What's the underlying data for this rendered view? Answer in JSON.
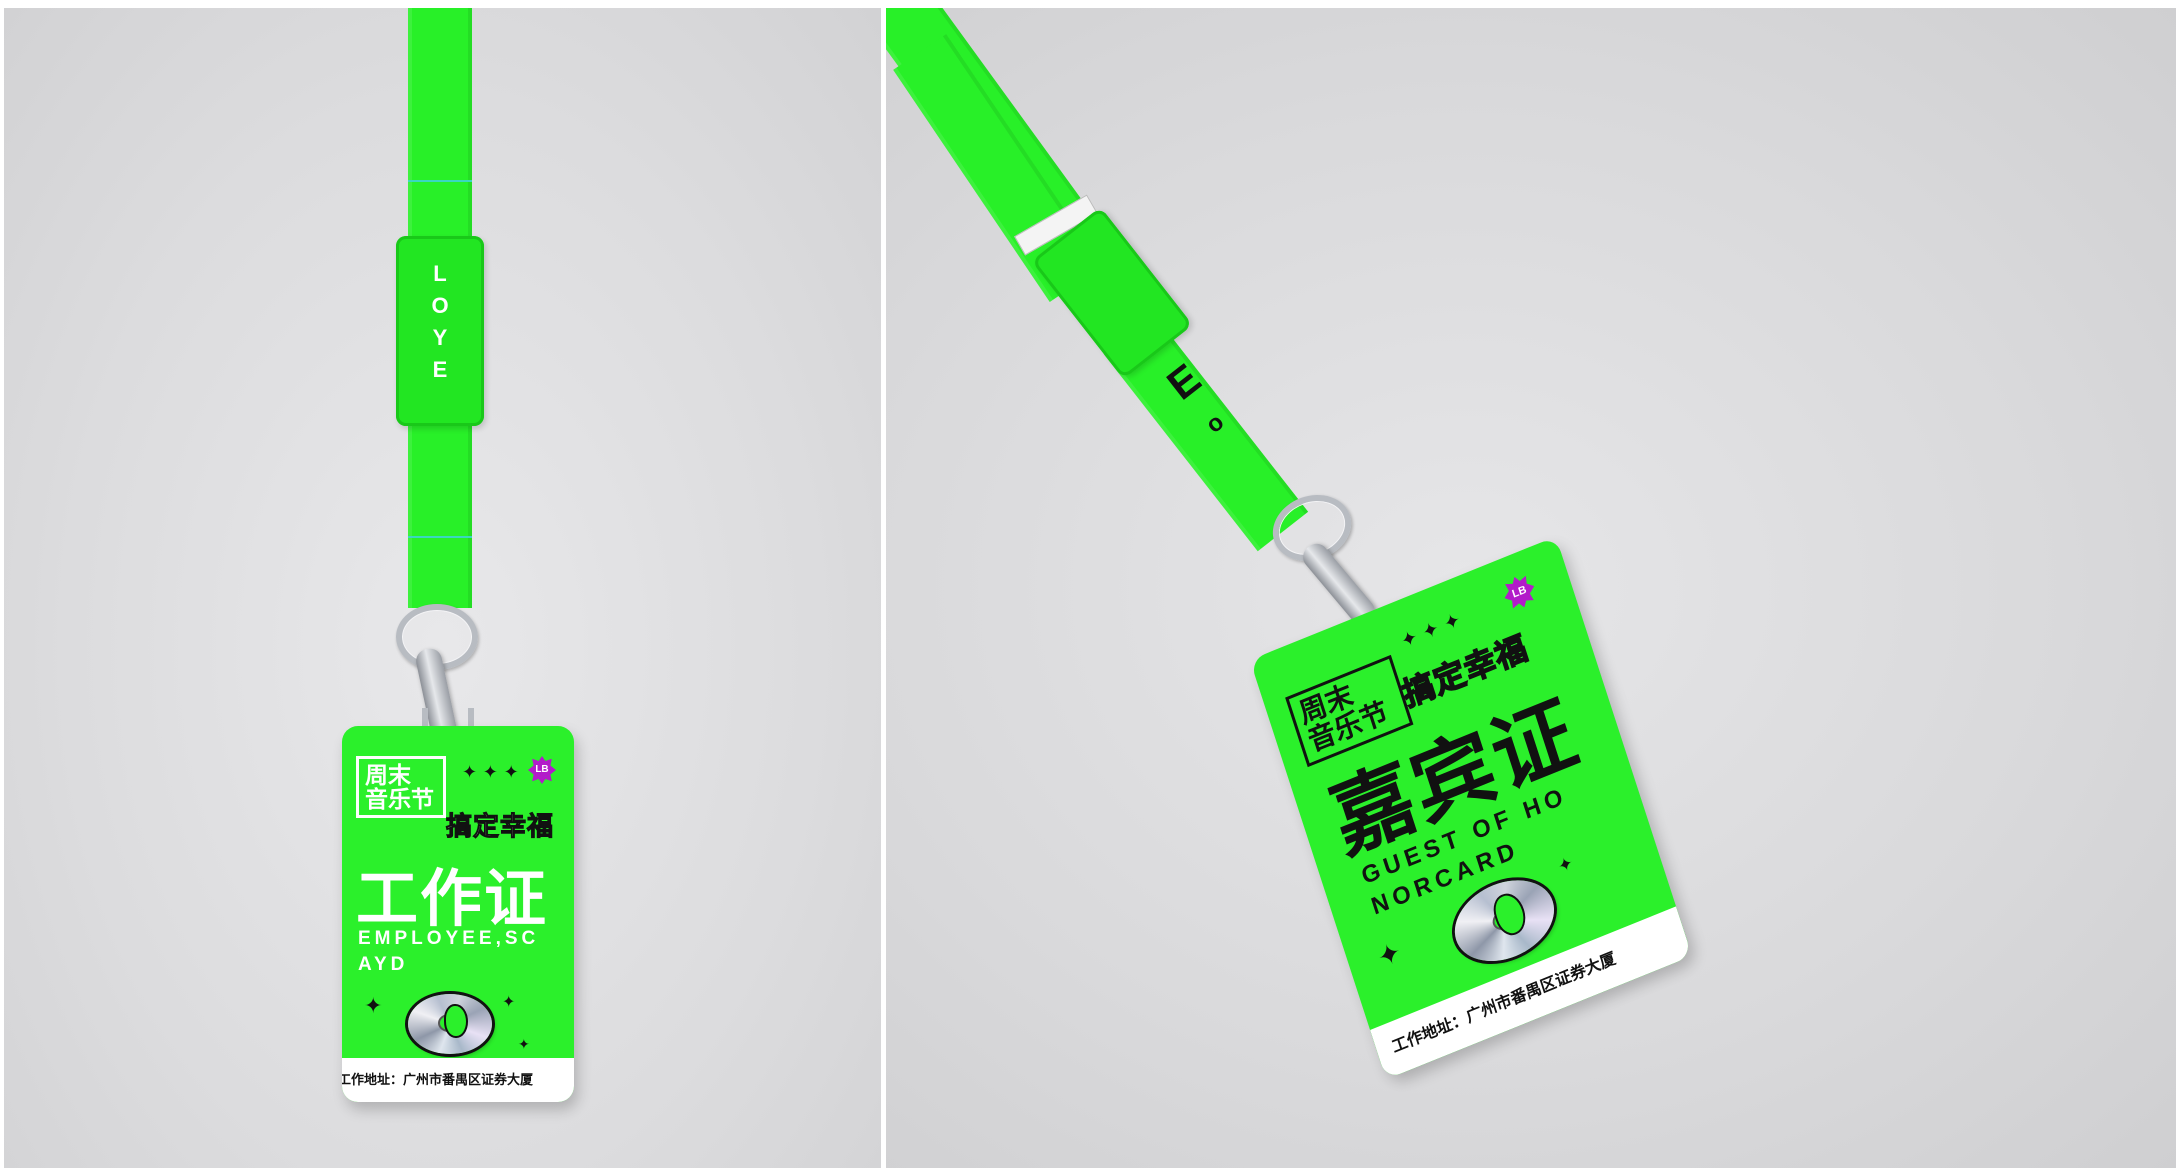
{
  "left_mockup": {
    "buckle_letters": [
      "L",
      "O",
      "Y",
      "E"
    ],
    "badge": {
      "event_name_line1": "周末",
      "event_name_line2": "音乐节",
      "slogan": "搞定幸福",
      "title": "工作证",
      "subtitle_line1": "EMPLOYEE,SC",
      "subtitle_line2": "AYD",
      "corner_tag": "LB",
      "footer": "工作地址：广州市番禺区证券大厦"
    }
  },
  "right_mockup": {
    "strap_letters": [
      "E",
      "o"
    ],
    "badge": {
      "event_name_line1": "周末",
      "event_name_line2": "音乐节",
      "slogan": "搞定幸福",
      "title": "嘉宾证",
      "subtitle_line1": "GUEST OF HO",
      "subtitle_line2": "NORCARD",
      "corner_tag": "LB",
      "footer": "工作地址：广州市番禺区证券大厦"
    }
  },
  "colors": {
    "lanyard_green": "#2bf02b",
    "background_grey": "#dcdcde",
    "accent_purple": "#b21cc9"
  }
}
